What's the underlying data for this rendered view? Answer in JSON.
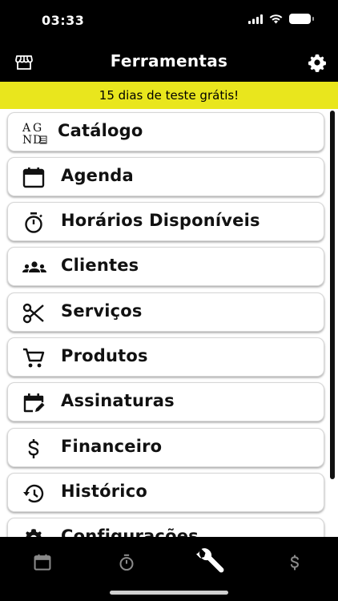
{
  "status_bar": {
    "time": "03:33"
  },
  "header": {
    "title": "Ferramentas"
  },
  "trial_banner": {
    "text": "15 dias de teste grátis!"
  },
  "menu": {
    "items": [
      {
        "label": "Catálogo",
        "icon": "catalog-logo-icon"
      },
      {
        "label": "Agenda",
        "icon": "calendar-icon"
      },
      {
        "label": "Horários Disponíveis",
        "icon": "stopwatch-icon"
      },
      {
        "label": "Clientes",
        "icon": "people-icon"
      },
      {
        "label": "Serviços",
        "icon": "scissors-icon"
      },
      {
        "label": "Produtos",
        "icon": "cart-icon"
      },
      {
        "label": "Assinaturas",
        "icon": "calendar-edit-icon"
      },
      {
        "label": "Financeiro",
        "icon": "dollar-icon"
      },
      {
        "label": "Histórico",
        "icon": "history-icon"
      },
      {
        "label": "Configurações",
        "icon": "gear-icon"
      }
    ]
  },
  "catalog_logo_text": "AGND",
  "tab_bar": {
    "tabs": [
      {
        "icon": "calendar-icon",
        "active": false
      },
      {
        "icon": "stopwatch-icon",
        "active": false
      },
      {
        "icon": "wrench-icon",
        "active": true
      },
      {
        "icon": "dollar-icon",
        "active": false
      }
    ]
  },
  "colors": {
    "banner": "#e9e61d",
    "bar": "#000000",
    "tab_inactive": "#8a8a8a",
    "tab_active": "#ffffff"
  }
}
